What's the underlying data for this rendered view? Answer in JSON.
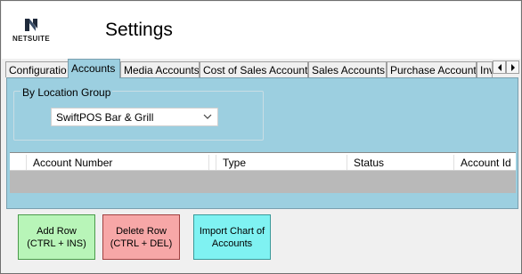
{
  "header": {
    "logo_text": "NETSUITE",
    "title": "Settings"
  },
  "tabs": [
    {
      "label": "Configuratio",
      "active": false
    },
    {
      "label": "Accounts",
      "active": true
    },
    {
      "label": "Media Accounts",
      "active": false
    },
    {
      "label": "Cost of Sales Account",
      "active": false
    },
    {
      "label": "Sales Accounts",
      "active": false
    },
    {
      "label": "Purchase Account",
      "active": false
    },
    {
      "label": "Inv",
      "active": false
    }
  ],
  "location_group": {
    "label": "By Location Group",
    "selected": "SwiftPOS Bar & Grill"
  },
  "grid": {
    "columns": [
      "Account Number",
      "Type",
      "Status",
      "Account Id"
    ]
  },
  "buttons": {
    "add": "Add Row\n(CTRL + INS)",
    "delete": "Delete Row\n(CTRL + DEL)",
    "import": "Import Chart of Accounts"
  },
  "colors": {
    "panel": "#9ccfe0",
    "add_button": "#b8f5b8",
    "delete_button": "#f7a7a7",
    "import_button": "#7ff2f2"
  },
  "icons": [
    "netsuite-logo-icon",
    "scroll-left-icon",
    "scroll-right-icon",
    "chevron-down-icon"
  ]
}
